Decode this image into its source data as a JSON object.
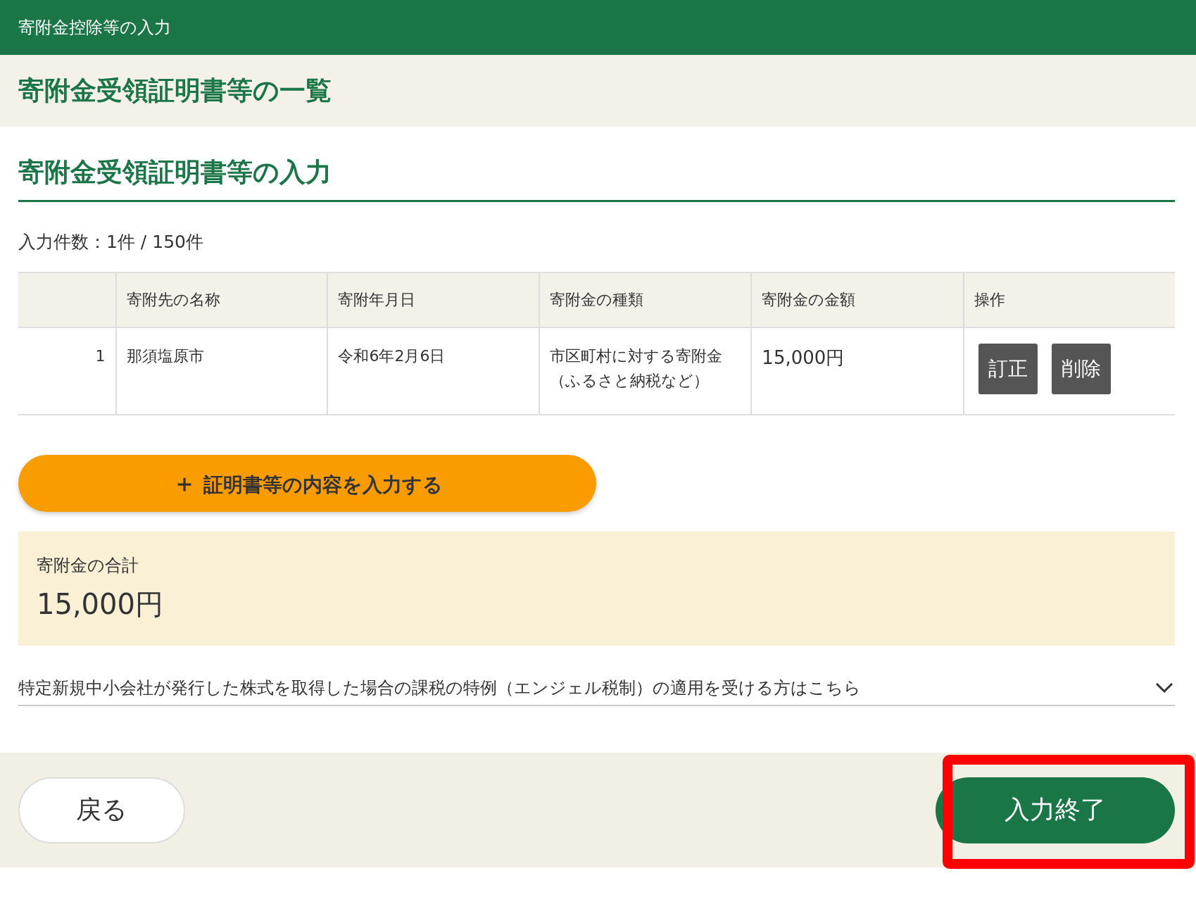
{
  "header": {
    "title": "寄附金控除等の入力"
  },
  "page_title": "寄附金受領証明書等の一覧",
  "section": {
    "heading": "寄附金受領証明書等の入力",
    "count": "入力件数：1件 / 150件"
  },
  "table": {
    "columns": [
      "",
      "寄附先の名称",
      "寄附年月日",
      "寄附金の種類",
      "寄附金の金額",
      "操作"
    ],
    "rows": [
      {
        "cells": [
          "1",
          "那須塩原市",
          "令和6年2月6日",
          "市区町村に対する寄附金（ふるさと納税など）",
          "15,000円"
        ],
        "actions": [
          "訂正",
          "削除"
        ]
      }
    ]
  },
  "add_button": {
    "icon": "＋",
    "label": "証明書等の内容を入力する"
  },
  "total": {
    "label": "寄附金の合計",
    "amount": "15,000円"
  },
  "accordion": {
    "label": "特定新規中小会社が発行した株式を取得した場合の課税の特例（エンジェル税制）の適用を受ける方はこちら",
    "expanded": false
  },
  "footer": {
    "back": "戻る",
    "finish": "入力終了",
    "finish_highlighted": true
  }
}
